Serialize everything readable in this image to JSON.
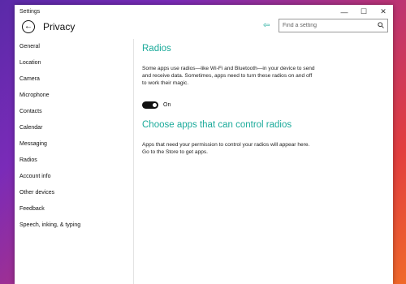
{
  "window": {
    "title": "Settings",
    "controls": {
      "minimize": "—",
      "maximize": "☐",
      "close": "✕"
    }
  },
  "header": {
    "back_glyph": "←",
    "title": "Privacy",
    "pin_glyph": "⇦"
  },
  "search": {
    "placeholder": "Find a setting"
  },
  "sidebar": {
    "items": [
      {
        "label": "General"
      },
      {
        "label": "Location"
      },
      {
        "label": "Camera"
      },
      {
        "label": "Microphone"
      },
      {
        "label": "Contacts"
      },
      {
        "label": "Calendar"
      },
      {
        "label": "Messaging"
      },
      {
        "label": "Radios"
      },
      {
        "label": "Account info"
      },
      {
        "label": "Other devices"
      },
      {
        "label": "Feedback"
      },
      {
        "label": "Speech, inking, & typing"
      }
    ]
  },
  "main": {
    "radios_title": "Radios",
    "radios_desc": "Some apps use radios—like Wi-Fi and Bluetooth—in your device to send and receive data. Sometimes, apps need to turn these radios on and off to work their magic.",
    "toggle": {
      "label": "On",
      "state": true
    },
    "apps_title": "Choose apps that can control radios",
    "apps_desc": "Apps that need your permission to control your radios will appear here. Go to the Store to get apps."
  },
  "colors": {
    "accent": "#1aaa9a",
    "toggle_on": "#111111"
  }
}
